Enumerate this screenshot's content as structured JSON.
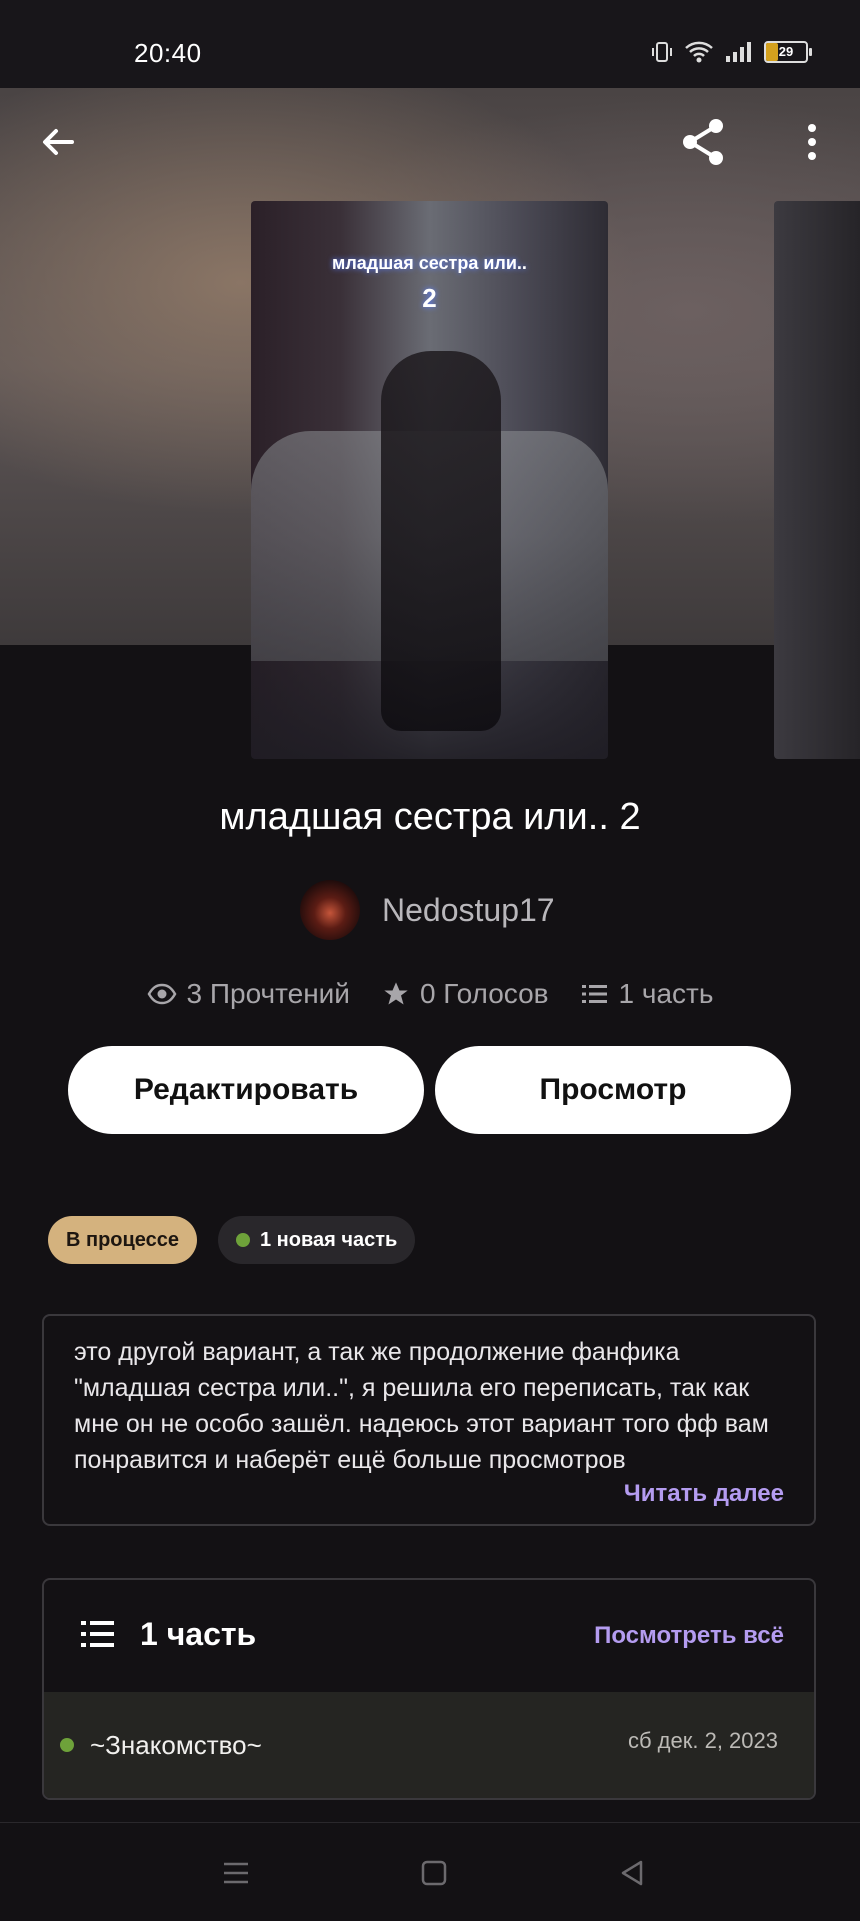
{
  "status_bar": {
    "time": "20:40",
    "battery": "29"
  },
  "toolbar": {
    "back_icon": "arrow-left-icon",
    "share_icon": "share-icon",
    "more_icon": "more-vertical-icon"
  },
  "cover": {
    "line1": "младшая сестра или..",
    "line2": "2"
  },
  "story": {
    "title": "младшая сестра или.. 2",
    "author": "Nedostup17",
    "stats": {
      "reads": "3 Прочтений",
      "votes": "0 Голосов",
      "parts": "1 часть"
    }
  },
  "buttons": {
    "edit": "Редактировать",
    "preview": "Просмотр"
  },
  "tags": {
    "status": "В процессе",
    "new_part": "1 новая часть"
  },
  "description": {
    "text": "это другой вариант, а так же продолжение фанфика \"младшая сестра или..\", я решила его переписать, так как мне он не особо зашёл. надеюсь этот вариант того фф вам понравится и наберёт ещё больше просмотров",
    "read_more": "Читать далее"
  },
  "parts_section": {
    "title": "1 часть",
    "see_all": "Посмотреть всё",
    "items": [
      {
        "name": "~Знакомство~",
        "date": "сб дек. 2, 2023"
      }
    ]
  },
  "colors": {
    "accent": "#b49cf0",
    "status_tag": "#d4b27e",
    "new_dot": "#6ea23a",
    "background": "#131114"
  }
}
